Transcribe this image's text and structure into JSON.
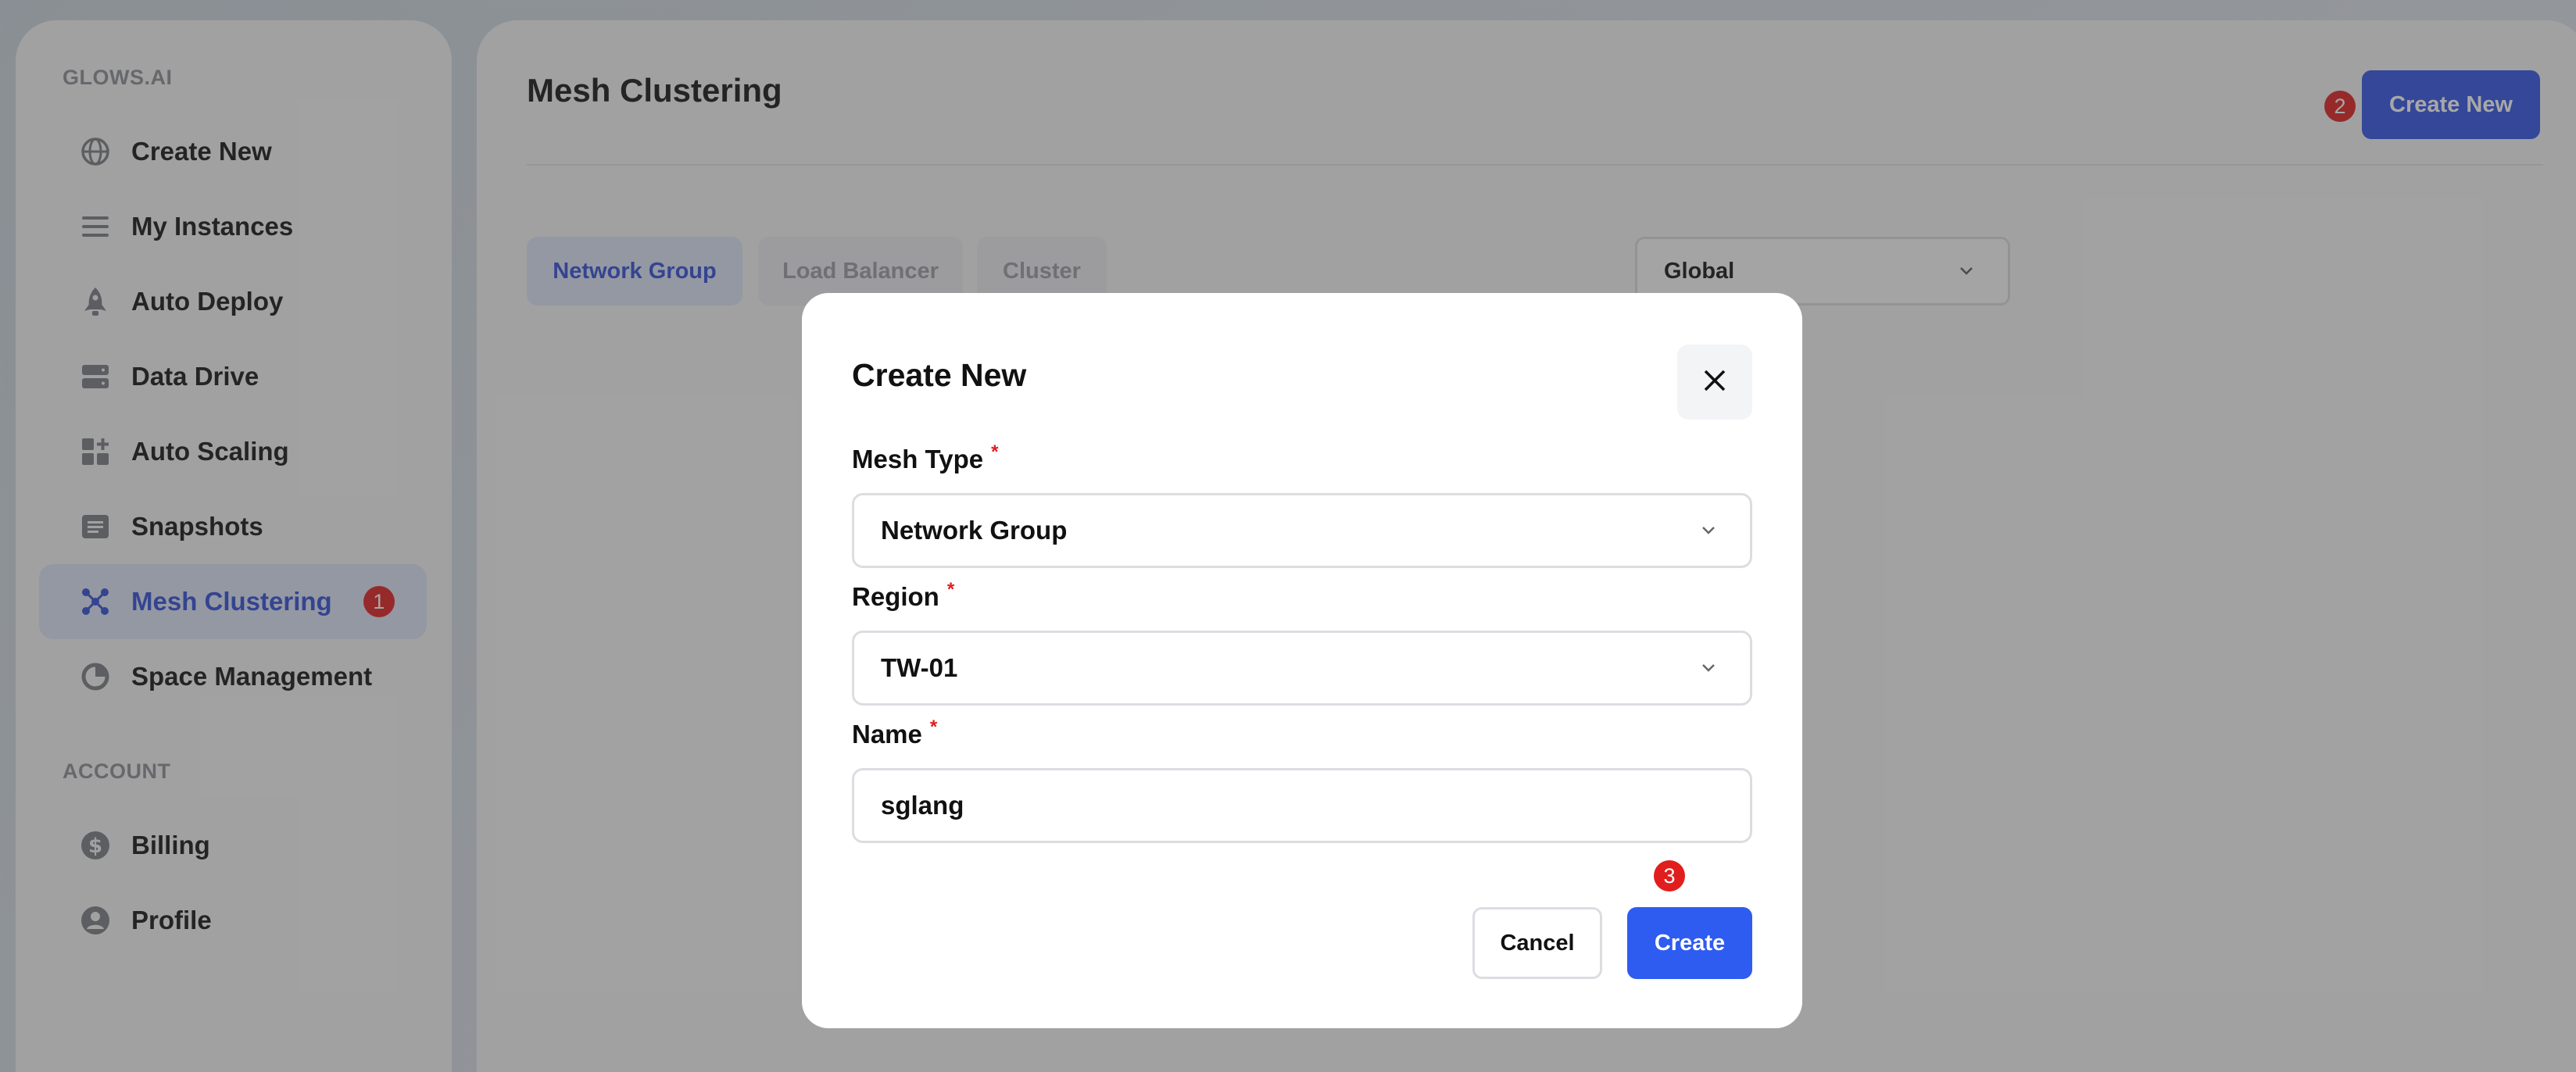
{
  "sidebar": {
    "brand": "GLOWS.AI",
    "account_heading": "ACCOUNT",
    "items": [
      {
        "label": "Create New",
        "icon": "globe-icon"
      },
      {
        "label": "My Instances",
        "icon": "list-icon"
      },
      {
        "label": "Auto Deploy",
        "icon": "rocket-icon"
      },
      {
        "label": "Data Drive",
        "icon": "server-icon"
      },
      {
        "label": "Auto Scaling",
        "icon": "grid-plus-icon"
      },
      {
        "label": "Snapshots",
        "icon": "snapshot-icon"
      },
      {
        "label": "Mesh Clustering",
        "icon": "mesh-icon",
        "active": true,
        "badge": "1"
      },
      {
        "label": "Space Management",
        "icon": "pie-icon"
      }
    ],
    "account_items": [
      {
        "label": "Billing",
        "icon": "dollar-icon"
      },
      {
        "label": "Profile",
        "icon": "user-icon"
      }
    ]
  },
  "header": {
    "title": "Mesh Clustering",
    "create_button": "Create New",
    "create_badge": "2"
  },
  "tabs": [
    {
      "label": "Network Group",
      "active": true
    },
    {
      "label": "Load Balancer"
    },
    {
      "label": "Cluster"
    }
  ],
  "region_filter": {
    "value": "Global"
  },
  "modal": {
    "title": "Create New",
    "mesh_type": {
      "label": "Mesh Type",
      "value": "Network Group"
    },
    "region": {
      "label": "Region",
      "value": "TW-01"
    },
    "name": {
      "label": "Name",
      "value": "sglang"
    },
    "required_mark": "*",
    "cancel_label": "Cancel",
    "create_label": "Create",
    "create_badge": "3"
  },
  "colors": {
    "accent": "#2e50e6",
    "active_bg": "#dde3f6",
    "badge": "#e11d1d"
  }
}
